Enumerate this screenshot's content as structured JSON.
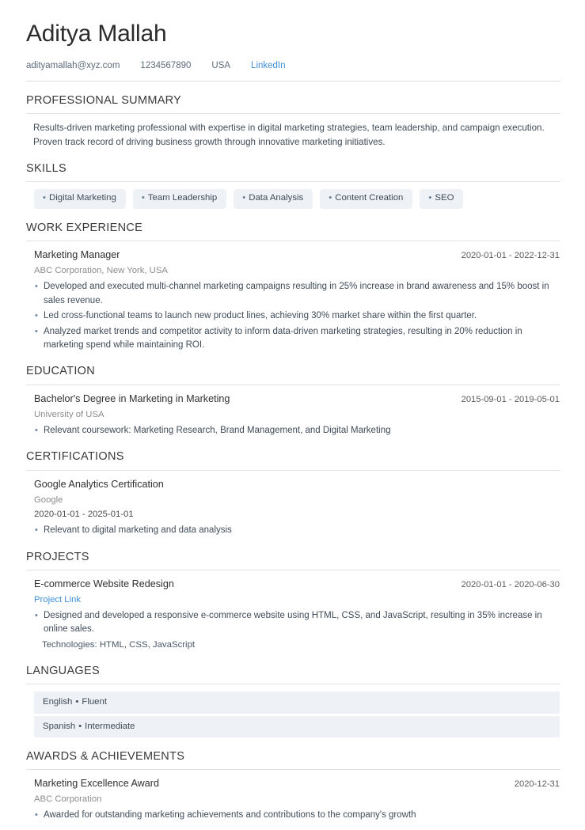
{
  "header": {
    "name": "Aditya Mallah",
    "contacts": [
      {
        "type": "email",
        "label": "adityamallah@xyz.com",
        "is_link": false
      },
      {
        "type": "phone",
        "label": "1234567890",
        "is_link": false
      },
      {
        "type": "location",
        "label": "USA",
        "is_link": false
      },
      {
        "type": "linkedin",
        "label": "LinkedIn",
        "is_link": true
      }
    ]
  },
  "colors": {
    "link": "#3d8ed6",
    "chip_bg": "#eef1f5",
    "rule": "#e2e2e2",
    "text": "#3f4b58",
    "muted": "#8b8b8b"
  },
  "sections": {
    "summary": {
      "title": "PROFESSIONAL SUMMARY",
      "text": "Results-driven marketing professional with expertise in digital marketing strategies, team leadership, and campaign execution. Proven track record of driving business growth through innovative marketing initiatives."
    },
    "skills": {
      "title": "SKILLS",
      "bullet": "•",
      "items": [
        "Digital Marketing",
        "Team Leadership",
        "Data Analysis",
        "Content Creation",
        "SEO"
      ]
    },
    "work": {
      "title": "WORK EXPERIENCE",
      "entries": [
        {
          "title": "Marketing Manager",
          "date": "2020-01-01 - 2022-12-31",
          "subtitle": "ABC Corporation, New York, USA",
          "bullets": [
            "Developed and executed multi-channel marketing campaigns resulting in 25% increase in brand awareness and 15% boost in sales revenue.",
            "Led cross-functional teams to launch new product lines, achieving 30% market share within the first quarter.",
            "Analyzed market trends and competitor activity to inform data-driven marketing strategies, resulting in 20% reduction in marketing spend while maintaining ROI."
          ]
        }
      ]
    },
    "education": {
      "title": "EDUCATION",
      "entries": [
        {
          "title": "Bachelor's Degree in Marketing in Marketing",
          "date": "2015-09-01 - 2019-05-01",
          "subtitle": "University of USA",
          "bullets": [
            "Relevant coursework: Marketing Research, Brand Management, and Digital Marketing"
          ]
        }
      ]
    },
    "certifications": {
      "title": "CERTIFICATIONS",
      "entries": [
        {
          "title": "Google Analytics Certification",
          "subtitle": "Google",
          "dateline": "2020-01-01 - 2025-01-01",
          "bullets": [
            "Relevant to digital marketing and data analysis"
          ]
        }
      ]
    },
    "projects": {
      "title": "PROJECTS",
      "entries": [
        {
          "title": "E-commerce Website Redesign",
          "date": "2020-01-01 - 2020-06-30",
          "link_label": "Project Link",
          "bullets": [
            "Designed and developed a responsive e-commerce website using HTML, CSS, and JavaScript, resulting in 35% increase in online sales."
          ],
          "technologies": "Technologies: HTML, CSS, JavaScript"
        }
      ]
    },
    "languages": {
      "title": "LANGUAGES",
      "separator": "•",
      "items": [
        {
          "name": "English",
          "level": "Fluent"
        },
        {
          "name": "Spanish",
          "level": "Intermediate"
        }
      ]
    },
    "awards": {
      "title": "AWARDS & ACHIEVEMENTS",
      "entries": [
        {
          "title": "Marketing Excellence Award",
          "date": "2020-12-31",
          "subtitle": "ABC Corporation",
          "bullets": [
            "Awarded for outstanding marketing achievements and contributions to the company's growth"
          ]
        }
      ]
    }
  }
}
